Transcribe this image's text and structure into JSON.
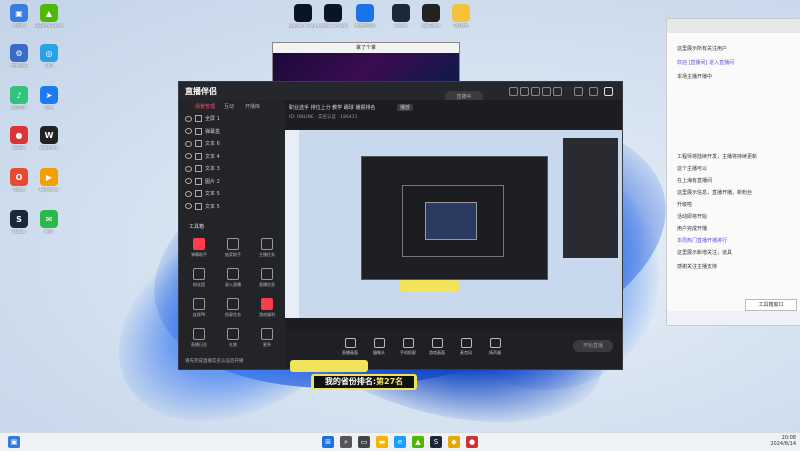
{
  "desktop": {
    "icons": [
      {
        "label": "此电脑",
        "color": "#3d7be0",
        "glyph": "▣"
      },
      {
        "label": "GeForce Experience",
        "color": "#4fb800",
        "glyph": "▲"
      },
      {
        "label": "控制面板",
        "color": "#3a6cc5",
        "glyph": "⚙"
      },
      {
        "label": "360",
        "color": "#2aa3e6",
        "glyph": "◎"
      },
      {
        "label": "QQ音乐",
        "color": "#31c27c",
        "glyph": "♪"
      },
      {
        "label": "迅雷",
        "color": "#1e7af0",
        "glyph": "➤"
      },
      {
        "label": "网易云",
        "color": "#d33",
        "glyph": "●"
      },
      {
        "label": "WeGame",
        "color": "#222",
        "glyph": "W"
      },
      {
        "label": "Office",
        "color": "#e84a2f",
        "glyph": "O"
      },
      {
        "label": "PotPlayer",
        "color": "#f2a000",
        "glyph": "▶"
      },
      {
        "label": "Steam",
        "color": "#1b2838",
        "glyph": "S"
      },
      {
        "label": "微信",
        "color": "#2db84d",
        "glyph": "✉"
      }
    ],
    "top_icons": [
      {
        "label": "League of Legends",
        "color": "#0a1428"
      },
      {
        "label": "League of Legends",
        "color": "#0a1428"
      },
      {
        "label": "雷神加速器",
        "color": "#1a73e8"
      },
      {
        "label": "Steam",
        "color": "#1b2838"
      },
      {
        "label": "WeGame",
        "color": "#222"
      },
      {
        "label": "QQ游戏",
        "color": "#f6c23e"
      }
    ]
  },
  "small_window": {
    "title": "掌了个掌"
  },
  "app": {
    "logo": "直播伴侣",
    "tabs": [
      "场景管理",
      "互动",
      "开播库"
    ],
    "sources": [
      "全屏 1",
      "弹幕盒",
      "文本 6",
      "文本 4",
      "文本 3",
      "图片 2",
      "文本 5",
      "文本 5"
    ],
    "tools_title": "工具箱",
    "tools": [
      "弹幕助手",
      "抽奖助手",
      "主播任务",
      "粉丝团",
      "录入直播",
      "直播信息",
      "连线PK",
      "投屏任务",
      "游戏福利",
      "直播日志",
      "礼物",
      "更多"
    ],
    "footer_text": "请先完成直播实名认证后开播",
    "header_line": "职业选手 排位上分 教学 踢球 播报排名",
    "header_badge": "播放",
    "sub_line": "ID: ONLINE · 实名认证 · 186411",
    "bottom_buttons": [
      "直播画面",
      "摄像头",
      "手机投屏",
      "游戏画面",
      "麦克风",
      "扬声器"
    ],
    "start_label": "开始直播",
    "live_pill": "直播中"
  },
  "overlay": {
    "rank_prefix": "我的省份排名:",
    "rank_value": "第27名"
  },
  "chat": {
    "messages": [
      "这里展示所有关注用户",
      "欢迎 [直播间] 进入直播间",
      "本场主播开播中",
      "工程师将陆续开发，主播将持续更新",
      "这个主播可以",
      "在上海有直播间",
      "这里展示信息，直播开播，新粉丝",
      "升级啦",
      "活动即将开始",
      "用户完成开播",
      "本周热门直播开播排行",
      "这里展示新增关注，道具",
      "感谢关注主播支持"
    ],
    "float_label": "工具箱窗口"
  },
  "taskbar": {
    "time": "20:08",
    "date": "2024/8/14"
  }
}
